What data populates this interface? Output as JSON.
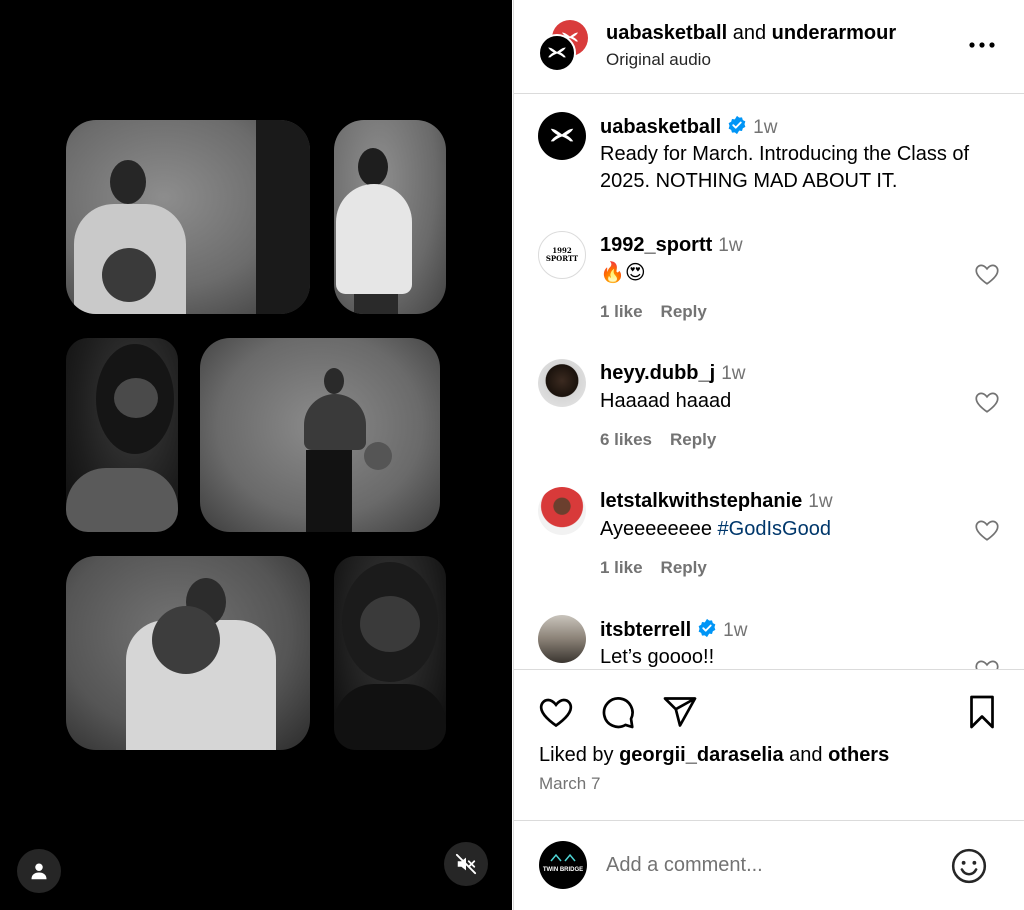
{
  "header": {
    "account_1": "uabasketball",
    "joiner": "and",
    "account_2": "underarmour",
    "audio": "Original audio"
  },
  "caption": {
    "user": "uabasketball",
    "time": "1w",
    "text": "Ready for March. Introducing the Class of 2025. NOTHING MAD ABOUT IT."
  },
  "comments": [
    {
      "user": "1992_sportt",
      "time": "1w",
      "text": "🔥😍",
      "likes": "1 like",
      "reply": "Reply",
      "avatar_text": "1992 SPORTT"
    },
    {
      "user": "heyy.dubb_j",
      "time": "1w",
      "text": "Haaaad haaad",
      "likes": "6 likes",
      "reply": "Reply"
    },
    {
      "user": "letstalkwithstephanie",
      "time": "1w",
      "text": "Ayeeeeeeee ",
      "hashtag": "#GodIsGood",
      "likes": "1 like",
      "reply": "Reply"
    },
    {
      "user": "itsbterrell",
      "time": "1w",
      "text": "Let’s goooo!!",
      "verified": true
    }
  ],
  "footer": {
    "liked_prefix": "Liked by",
    "liked_user": "georgii_daraselia",
    "liked_and": "and",
    "liked_others": "others",
    "date": "March 7",
    "comment_placeholder": "Add a comment...",
    "commenter_avatar_text": "TWIN BRIDGE"
  },
  "icons": {
    "more": "more-icon",
    "heart": "heart-icon",
    "comment": "comment-icon",
    "share": "share-icon",
    "bookmark": "bookmark-icon",
    "emoji": "emoji-icon",
    "profile": "profile-icon",
    "mute": "mute-icon"
  },
  "colors": {
    "accent_link": "#00376b",
    "verified": "#0095f6",
    "muted_text": "#737373",
    "brand_red": "#d93b3b"
  }
}
